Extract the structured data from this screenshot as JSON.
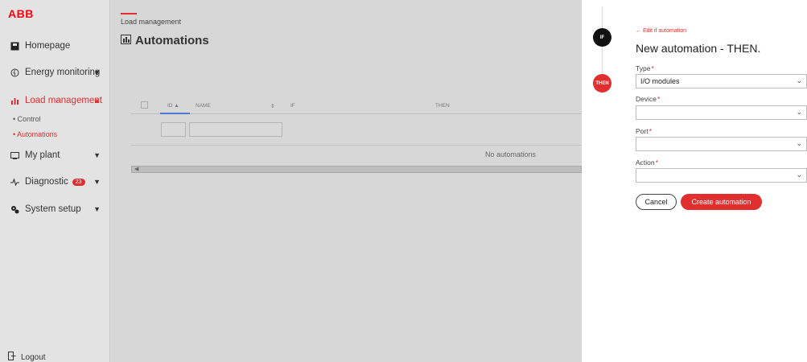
{
  "logo": "ABB",
  "sidebar": {
    "items": [
      {
        "label": "Homepage",
        "icon": "home-icon"
      },
      {
        "label": "Energy monitoring",
        "icon": "energy-icon"
      },
      {
        "label": "Load management",
        "icon": "load-management-icon"
      },
      {
        "label": "My plant",
        "icon": "plant-icon"
      },
      {
        "label": "Diagnostic",
        "icon": "diagnostic-icon",
        "badge": "23"
      },
      {
        "label": "System setup",
        "icon": "setup-icon"
      }
    ],
    "sub_items": [
      {
        "label": "Control"
      },
      {
        "label": "Automations"
      }
    ],
    "logout": "Logout"
  },
  "main": {
    "breadcrumb": "Load management",
    "title": "Automations",
    "table": {
      "columns": [
        "ID ▲",
        "NAME",
        "IF",
        "THEN"
      ],
      "empty_text": "No automations"
    }
  },
  "stepper": {
    "if_label": "IF",
    "then_label": "THEN"
  },
  "panel": {
    "back_link": "← Edit if automation",
    "title": "New automation - THEN.",
    "fields": [
      {
        "label": "Type",
        "value": "I/O modules"
      },
      {
        "label": "Device",
        "value": ""
      },
      {
        "label": "Port",
        "value": ""
      },
      {
        "label": "Action",
        "value": ""
      }
    ],
    "cancel_label": "Cancel",
    "create_label": "Create automation"
  },
  "colors": {
    "accent": "#e12e2e",
    "overlay": "#d7d7d7",
    "id_underline": "#4a7bd4"
  }
}
